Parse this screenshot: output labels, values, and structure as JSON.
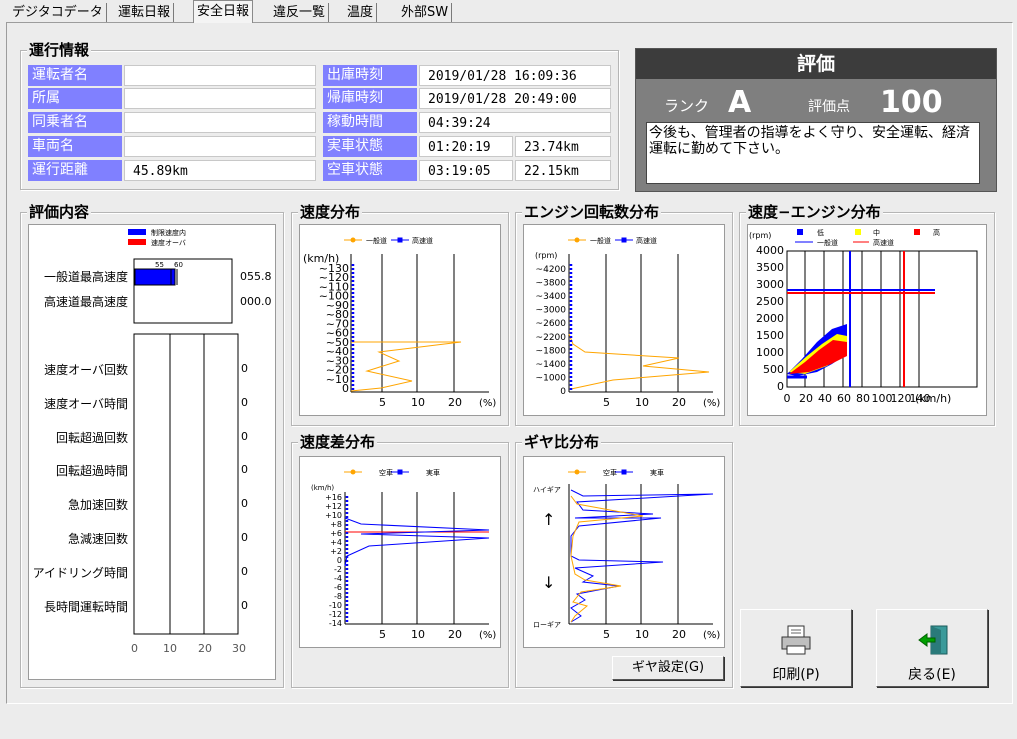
{
  "tabs": [
    {
      "label": "デジタコデータ",
      "active": false
    },
    {
      "label": "運転日報",
      "active": false
    },
    {
      "label": "安全日報",
      "active": true
    },
    {
      "label": "違反一覧",
      "active": false
    },
    {
      "label": "温度",
      "active": false
    },
    {
      "label": "外部SW",
      "active": false
    }
  ],
  "operation": {
    "title": "運行情報",
    "driver_label": "運転者名",
    "driver_value": "",
    "dept_label": "所属",
    "dept_value": "",
    "codriver_label": "同乗者名",
    "codriver_value": "",
    "vehicle_label": "車両名",
    "vehicle_value": "",
    "distance_label": "運行距離",
    "distance_value": "45.89km",
    "depart_label": "出庫時刻",
    "depart_value": "2019/01/28 16:09:36",
    "return_label": "帰庫時刻",
    "return_value": "2019/01/28 20:49:00",
    "worktime_label": "稼動時間",
    "worktime_value": "04:39:24",
    "loaded_label": "実車状態",
    "loaded_time": "01:20:19",
    "loaded_dist": "23.74km",
    "empty_label": "空車状態",
    "empty_time": "03:19:05",
    "empty_dist": "22.15km"
  },
  "evaluation": {
    "title": "評価",
    "rank_label": "ランク",
    "rank_value": "A",
    "score_label": "評価点",
    "score_value": "100",
    "comment": "今後も、管理者の指導をよく守り、安全運転、経済運転に勤めて下さい。"
  },
  "eval_content": {
    "title": "評価内容",
    "legend_within": "制限速度内",
    "legend_over": "速度オーバ",
    "bar_labels": [
      "55",
      "60"
    ],
    "max_general_label": "一般道最高速度",
    "max_general_value": "055.8",
    "max_highway_label": "高速道最高速度",
    "max_highway_value": "000.0",
    "rows": [
      {
        "label": "速度オーバ回数",
        "value": "0"
      },
      {
        "label": "速度オーバ時間",
        "value": "0"
      },
      {
        "label": "回転超過回数",
        "value": "0"
      },
      {
        "label": "回転超過時間",
        "value": "0"
      },
      {
        "label": "急加速回数",
        "value": "0"
      },
      {
        "label": "急減速回数",
        "value": "0"
      },
      {
        "label": "アイドリング時間",
        "value": "0"
      },
      {
        "label": "長時間運転時間",
        "value": "0"
      }
    ],
    "xticks": [
      "0",
      "10",
      "20",
      "30"
    ]
  },
  "speed_dist": {
    "title": "速度分布",
    "legend": [
      "一般道",
      "高速道"
    ],
    "yunit": "(km/h)",
    "yticks": [
      "~130",
      "~120",
      "~110",
      "~100",
      "~90",
      "~80",
      "~70",
      "~60",
      "~50",
      "~40",
      "~30",
      "~20",
      "~10",
      "0"
    ],
    "xticks": [
      "5",
      "10",
      "20",
      "(%)"
    ]
  },
  "engine_dist": {
    "title": "エンジン回転数分布",
    "legend": [
      "一般道",
      "高速道"
    ],
    "yunit": "(rpm)",
    "yticks": [
      "~4200",
      "~3800",
      "~3400",
      "~3000",
      "~2600",
      "~2200",
      "~1800",
      "~1400",
      "~1000",
      "0"
    ],
    "xticks": [
      "5",
      "10",
      "20",
      "(%)"
    ]
  },
  "speed_engine": {
    "title": "速度−エンジン分布",
    "yunit": "(rpm)",
    "legend": [
      "低",
      "中",
      "高",
      "一般道",
      "高速道"
    ],
    "yticks": [
      "4000",
      "3500",
      "3000",
      "2500",
      "2000",
      "1500",
      "1000",
      "500",
      "0"
    ],
    "xticks": [
      "0",
      "20",
      "40",
      "60",
      "80",
      "100",
      "120",
      "140"
    ],
    "xunit": "(km/h)"
  },
  "speed_diff": {
    "title": "速度差分布",
    "legend": [
      "空車",
      "実車"
    ],
    "yunit": "(km/h)",
    "yticks": [
      "+16",
      "+12",
      "+10",
      "+8",
      "+6",
      "+4",
      "+2",
      "0",
      "-2",
      "-4",
      "-6",
      "-8",
      "-10",
      "-12",
      "-14"
    ],
    "xticks": [
      "5",
      "10",
      "20",
      "(%)"
    ]
  },
  "gear_dist": {
    "title": "ギヤ比分布",
    "legend": [
      "空車",
      "実車"
    ],
    "high_label": "ハイギア",
    "low_label": "ローギア",
    "up_arrow": "↑",
    "down_arrow": "↓",
    "xticks": [
      "5",
      "10",
      "20",
      "(%)"
    ]
  },
  "buttons": {
    "gear_setting": "ギヤ設定(G)",
    "print": "印刷(P)",
    "back": "戻る(E)"
  },
  "colors": {
    "accent": "#8080ff",
    "general": "#ffa500",
    "highway": "#0000ff",
    "over": "#ff0000"
  },
  "chart_data": [
    {
      "type": "line",
      "title": "速度分布",
      "ylabel": "(km/h)",
      "xlabel": "(%)",
      "series": [
        {
          "name": "一般道",
          "x_percent": [
            0,
            0,
            0,
            0,
            0,
            0,
            0.5,
            22.5,
            2,
            4,
            1,
            9,
            6,
            0
          ],
          "y": [
            "~130",
            "~120",
            "~110",
            "~100",
            "~90",
            "~80",
            "~70",
            "~60",
            "~50",
            "~40",
            "~30",
            "~20",
            "~10",
            "0"
          ]
        },
        {
          "name": "高速道",
          "x_percent": [
            0,
            0,
            0,
            0,
            0,
            0,
            0,
            0,
            0,
            0,
            0,
            0,
            0,
            0
          ]
        }
      ]
    },
    {
      "type": "line",
      "title": "エンジン回転数分布",
      "ylabel": "(rpm)",
      "xlabel": "(%)",
      "series": [
        {
          "name": "一般道",
          "x_percent": [
            0,
            0,
            0,
            0,
            0,
            0,
            0.5,
            15,
            10,
            26,
            0
          ],
          "y": [
            "~4200",
            "~3800",
            "~3400",
            "~3000",
            "~2600",
            "~2200",
            "~1800",
            "~1400",
            "~1000",
            "0"
          ]
        },
        {
          "name": "高速道",
          "x_percent": [
            0,
            0,
            0,
            0,
            0,
            0,
            0,
            0,
            0,
            0,
            0
          ]
        }
      ]
    },
    {
      "type": "line",
      "title": "速度差分布",
      "ylabel": "(km/h)",
      "xlabel": "(%)",
      "series": [
        {
          "name": "空車",
          "x_percent": [
            0,
            0,
            0,
            0,
            0,
            0,
            0,
            0,
            0,
            0,
            0,
            0,
            0,
            0,
            0
          ]
        },
        {
          "name": "実車",
          "x_percent": [
            0,
            0,
            0,
            0,
            0,
            1,
            28,
            28,
            2,
            0,
            0,
            0,
            0,
            0,
            0
          ]
        }
      ]
    },
    {
      "type": "line",
      "title": "ギヤ比分布",
      "xlabel": "(%)",
      "series": [
        {
          "name": "空車",
          "x_percent": [
            0,
            2,
            0,
            10,
            2,
            0,
            0,
            0,
            0,
            0,
            5,
            0,
            0,
            3,
            0,
            2,
            0
          ]
        },
        {
          "name": "実車",
          "x_percent": [
            0,
            3,
            25,
            0,
            13,
            1,
            0,
            0,
            0,
            0,
            16,
            1,
            3,
            0,
            2,
            0,
            0
          ]
        }
      ]
    },
    {
      "type": "scatter",
      "title": "速度−エンジン分布",
      "xlabel": "(km/h)",
      "ylabel": "(rpm)",
      "xlim": [
        0,
        140
      ],
      "ylim": [
        0,
        4000
      ],
      "series": [
        {
          "name": "一般道",
          "rpm": 2850
        },
        {
          "name": "高速道",
          "rpm": 2900
        }
      ]
    }
  ]
}
